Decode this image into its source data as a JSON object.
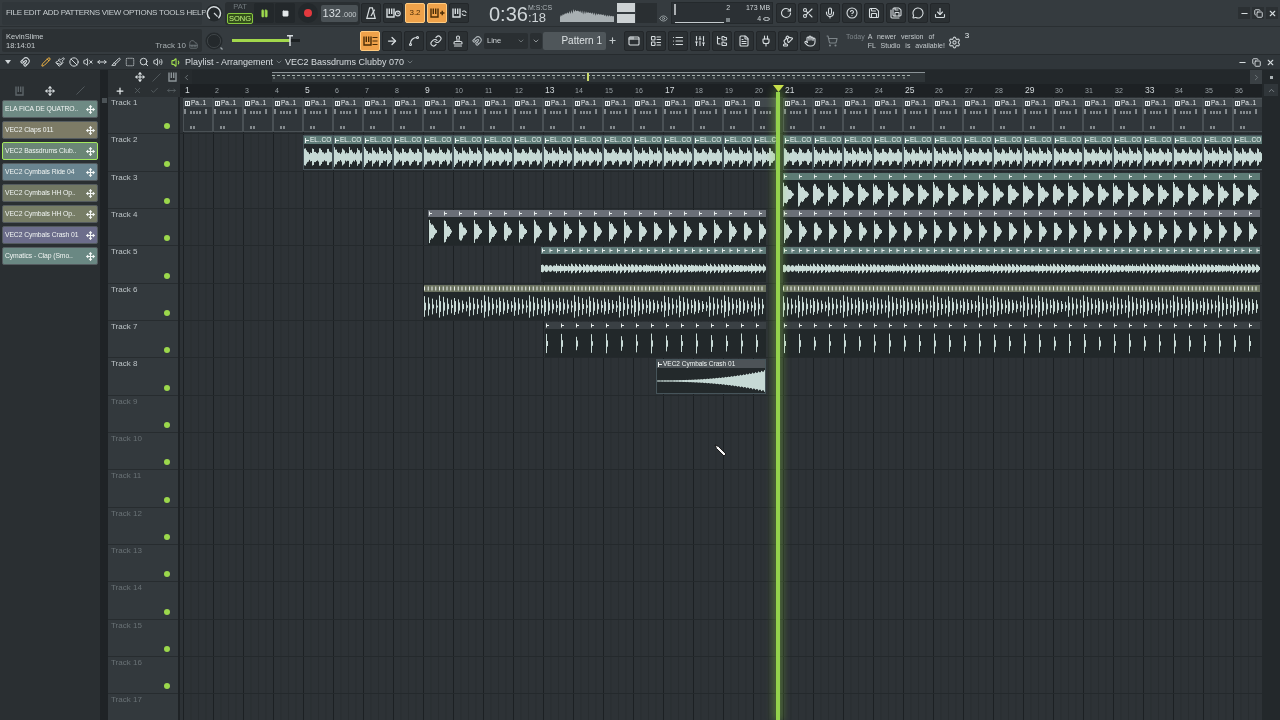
{
  "menu": [
    "FILE",
    "EDIT",
    "ADD",
    "PATTERNS",
    "VIEW",
    "OPTIONS",
    "TOOLS",
    "HELP"
  ],
  "hint_panel": {
    "title": "KevinSlime",
    "time": "18:14:01",
    "context": "Track 10"
  },
  "transport": {
    "modes": [
      {
        "label": "PAT",
        "selected": false
      },
      {
        "label": "SONG",
        "selected": true
      }
    ],
    "playing": true,
    "tempo": "132",
    "tempo_fraction": ".000"
  },
  "master_volume": {
    "level": 0.86
  },
  "record_options": [
    {
      "active": false
    },
    {
      "active": false
    },
    {
      "label": "3.2",
      "active": true
    },
    {
      "active": true
    },
    {
      "active": false
    }
  ],
  "clock": {
    "time": "0:36",
    "fraction": ":18",
    "unit": "M:S:CS"
  },
  "performance": {
    "readouts": [
      "2",
      "173 MB",
      "4"
    ]
  },
  "draw_tools": [
    {
      "active": true
    },
    {
      "active": false
    },
    {
      "active": false
    },
    {
      "active": false
    },
    {
      "active": false
    }
  ],
  "snap": {
    "value": "Line"
  },
  "pattern_selector": {
    "value": "Pattern 1"
  },
  "news": {
    "date": "Today",
    "message": "A newer version of FL Studio is available!"
  },
  "settings_badge": "3",
  "playlist": {
    "title": "Playlist - Arrangement",
    "clip_source": "VEC2 Bassdrums Clubby 070",
    "tools": [
      {
        "selected": true
      },
      {
        "selected": false
      },
      {
        "selected": false
      },
      {
        "selected": false
      },
      {
        "selected": false
      },
      {
        "selected": false
      },
      {
        "selected": false
      },
      {
        "selected": false
      },
      {
        "selected": false
      }
    ],
    "ruler": [
      "1",
      "2",
      "3",
      "4",
      "5",
      "6",
      "7",
      "8",
      "9",
      "10",
      "11",
      "12",
      "13",
      "14",
      "15",
      "16",
      "17",
      "18",
      "19",
      "20",
      "21",
      "22",
      "23",
      "24",
      "25",
      "26",
      "27",
      "28",
      "29",
      "30",
      "31",
      "32",
      "33",
      "34",
      "35",
      "36"
    ],
    "picker": [
      {
        "label": "ELA FICA DE QUATRO..",
        "color": "#6e8a84",
        "selected": false
      },
      {
        "label": "VEC2 Claps 011",
        "color": "#7d7b66",
        "selected": false
      },
      {
        "label": "VEC2 Bassdrums Club..",
        "color": "#6a8576",
        "selected": true
      },
      {
        "label": "VEC2 Cymbals Ride 04",
        "color": "#6a8590",
        "selected": false
      },
      {
        "label": "VEC2 Cymbals HH Op..",
        "color": "#727864",
        "selected": false
      },
      {
        "label": "VEC2 Cymbals HH Op..",
        "color": "#777d66",
        "selected": false
      },
      {
        "label": "VEC2 Cymbals Crash 01",
        "color": "#6c6d8b",
        "selected": false
      },
      {
        "label": "Cymatics - Clap (Smo..",
        "color": "#6a8883",
        "selected": false
      }
    ],
    "tracks": [
      {
        "name": "Track 1",
        "active": true,
        "dimmed": false,
        "clips": [
          {
            "kind": "pattern",
            "label": "Pa..1"
          },
          {
            "kind": "pattern",
            "label": "Pa..1"
          },
          {
            "kind": "pattern",
            "label": "Pa..1"
          },
          {
            "kind": "pattern",
            "label": "Pa..1"
          },
          {
            "kind": "pattern",
            "label": "Pa..1"
          },
          {
            "kind": "pattern",
            "label": "Pa..1"
          },
          {
            "kind": "pattern",
            "label": "Pa..1"
          },
          {
            "kind": "pattern",
            "label": "Pa..1"
          },
          {
            "kind": "pattern",
            "label": "Pa..1"
          },
          {
            "kind": "pattern",
            "label": "Pa..1"
          },
          {
            "kind": "pattern",
            "label": "Pa..1"
          },
          {
            "kind": "pattern",
            "label": "Pa..1"
          },
          {
            "kind": "pattern",
            "label": "Pa..1"
          },
          {
            "kind": "pattern",
            "label": "Pa..1"
          },
          {
            "kind": "pattern",
            "label": "Pa..1"
          },
          {
            "kind": "pattern",
            "label": "Pa..1"
          },
          {
            "kind": "pattern",
            "label": "Pa..1"
          },
          {
            "kind": "pattern",
            "label": "Pa..1"
          },
          {
            "kind": "pattern",
            "label": "Pa..1"
          },
          {
            "kind": "pattern"
          },
          {
            "kind": "pattern",
            "label": "Pa..1"
          },
          {
            "kind": "pattern",
            "label": "Pa..1"
          },
          {
            "kind": "pattern",
            "label": "Pa..1"
          },
          {
            "kind": "pattern",
            "label": "Pa..1"
          },
          {
            "kind": "pattern",
            "label": "Pa..1"
          },
          {
            "kind": "pattern",
            "label": "Pa..1"
          },
          {
            "kind": "pattern",
            "label": "Pa..1"
          },
          {
            "kind": "pattern",
            "label": "Pa..1"
          },
          {
            "kind": "pattern",
            "label": "Pa..1"
          },
          {
            "kind": "pattern",
            "label": "Pa..1"
          },
          {
            "kind": "pattern",
            "label": "Pa..1"
          },
          {
            "kind": "pattern",
            "label": "Pa..1"
          },
          {
            "kind": "pattern",
            "label": "Pa..1"
          },
          {
            "kind": "pattern",
            "label": "Pa..1"
          },
          {
            "kind": "pattern",
            "label": "Pa..1"
          },
          {
            "kind": "pattern",
            "label": "Pa..1"
          }
        ]
      },
      {
        "name": "Track 2",
        "active": true,
        "dimmed": false,
        "clips": [
          {
            "kind": "audio",
            "label": "EL..CO"
          },
          {
            "kind": "audio",
            "label": "EL..CO"
          },
          {
            "kind": "audio",
            "label": "EL..CO"
          },
          {
            "kind": "audio",
            "label": "EL..CO"
          },
          {
            "kind": "audio",
            "label": "EL..CO"
          },
          {
            "kind": "audio",
            "label": "EL..CO"
          },
          {
            "kind": "audio",
            "label": "EL..CO"
          },
          {
            "kind": "audio",
            "label": "EL..CO"
          },
          {
            "kind": "audio",
            "label": "EL..CO"
          },
          {
            "kind": "audio",
            "label": "EL..CO"
          },
          {
            "kind": "audio",
            "label": "EL..CO"
          },
          {
            "kind": "audio",
            "label": "EL..CO"
          },
          {
            "kind": "audio",
            "label": "EL..CO"
          },
          {
            "kind": "audio",
            "label": "EL..CO"
          },
          {
            "kind": "audio",
            "label": "EL..CO"
          },
          {
            "kind": "audio",
            "label": "EL..C"
          },
          {
            "kind": "audio",
            "label": "EL..CO"
          },
          {
            "kind": "audio",
            "label": "EL..CO"
          },
          {
            "kind": "audio",
            "label": "EL..CO"
          },
          {
            "kind": "audio",
            "label": "EL..CO"
          },
          {
            "kind": "audio",
            "label": "EL..CO"
          },
          {
            "kind": "audio",
            "label": "EL..CO"
          },
          {
            "kind": "audio",
            "label": "EL..CO"
          },
          {
            "kind": "audio",
            "label": "EL..CO"
          },
          {
            "kind": "audio",
            "label": "EL..CO"
          },
          {
            "kind": "audio",
            "label": "EL..CO"
          },
          {
            "kind": "audio",
            "label": "EL..CO"
          },
          {
            "kind": "audio",
            "label": "EL..CO"
          },
          {
            "kind": "audio",
            "label": "EL..CO"
          },
          {
            "kind": "audio",
            "label": "EL..CO"
          },
          {
            "kind": "audio",
            "label": "EL..CO"
          },
          {
            "kind": "audio",
            "label": "EL..CO"
          }
        ]
      },
      {
        "name": "Track 3",
        "active": true,
        "dimmed": false
      },
      {
        "name": "Track 4",
        "active": true,
        "dimmed": false
      },
      {
        "name": "Track 5",
        "active": true,
        "dimmed": false
      },
      {
        "name": "Track 6",
        "active": true,
        "dimmed": false
      },
      {
        "name": "Track 7",
        "active": true,
        "dimmed": false
      },
      {
        "name": "Track 8",
        "active": true,
        "dimmed": false,
        "clips": [
          {
            "kind": "audio",
            "label": "VEC2 Cymbals Crash 01"
          }
        ]
      },
      {
        "name": "Track 9",
        "active": true,
        "dimmed": true
      },
      {
        "name": "Track 10",
        "active": true,
        "dimmed": true
      },
      {
        "name": "Track 11",
        "active": true,
        "dimmed": true
      },
      {
        "name": "Track 12",
        "active": true,
        "dimmed": true
      },
      {
        "name": "Track 13",
        "active": true,
        "dimmed": true
      },
      {
        "name": "Track 14",
        "active": true,
        "dimmed": true
      },
      {
        "name": "Track 15",
        "active": true,
        "dimmed": true
      },
      {
        "name": "Track 16",
        "active": true,
        "dimmed": true
      },
      {
        "name": "Track 17",
        "dimmed": true
      }
    ]
  }
}
